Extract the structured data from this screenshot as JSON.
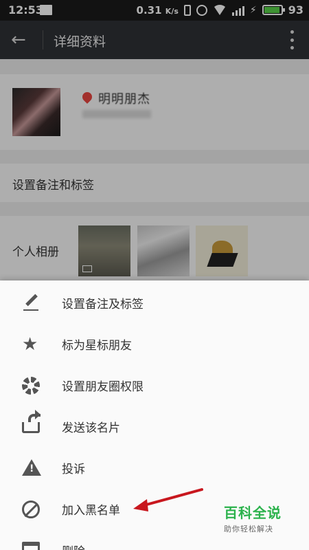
{
  "status_bar": {
    "time": "12:53",
    "net_speed": "0.31",
    "net_speed_unit": "K/s",
    "battery": "93",
    "battery_color": "#5ad14a"
  },
  "app_bar": {
    "back_icon": "arrow-left-icon",
    "title": "详细资料",
    "more_icon": "more-vertical-icon"
  },
  "profile": {
    "name": "明明朋杰",
    "pin_color": "#e9453f"
  },
  "remark_row": {
    "label": "设置备注和标签"
  },
  "album_row": {
    "label": "个人相册"
  },
  "menu": {
    "items": [
      {
        "icon": "pencil-icon",
        "label": "设置备注及标签"
      },
      {
        "icon": "star-icon",
        "label": "标为星标朋友"
      },
      {
        "icon": "aperture-icon",
        "label": "设置朋友圈权限"
      },
      {
        "icon": "share-icon",
        "label": "发送该名片"
      },
      {
        "icon": "warning-icon",
        "label": "投诉"
      },
      {
        "icon": "block-icon",
        "label": "加入黑名单"
      },
      {
        "icon": "trash-icon",
        "label": "删除"
      }
    ]
  },
  "annotation": {
    "arrow_color": "#c8171e"
  },
  "watermark": {
    "main": "百科全说",
    "sub": "助你轻松解决",
    "color": "#2bb24c"
  }
}
